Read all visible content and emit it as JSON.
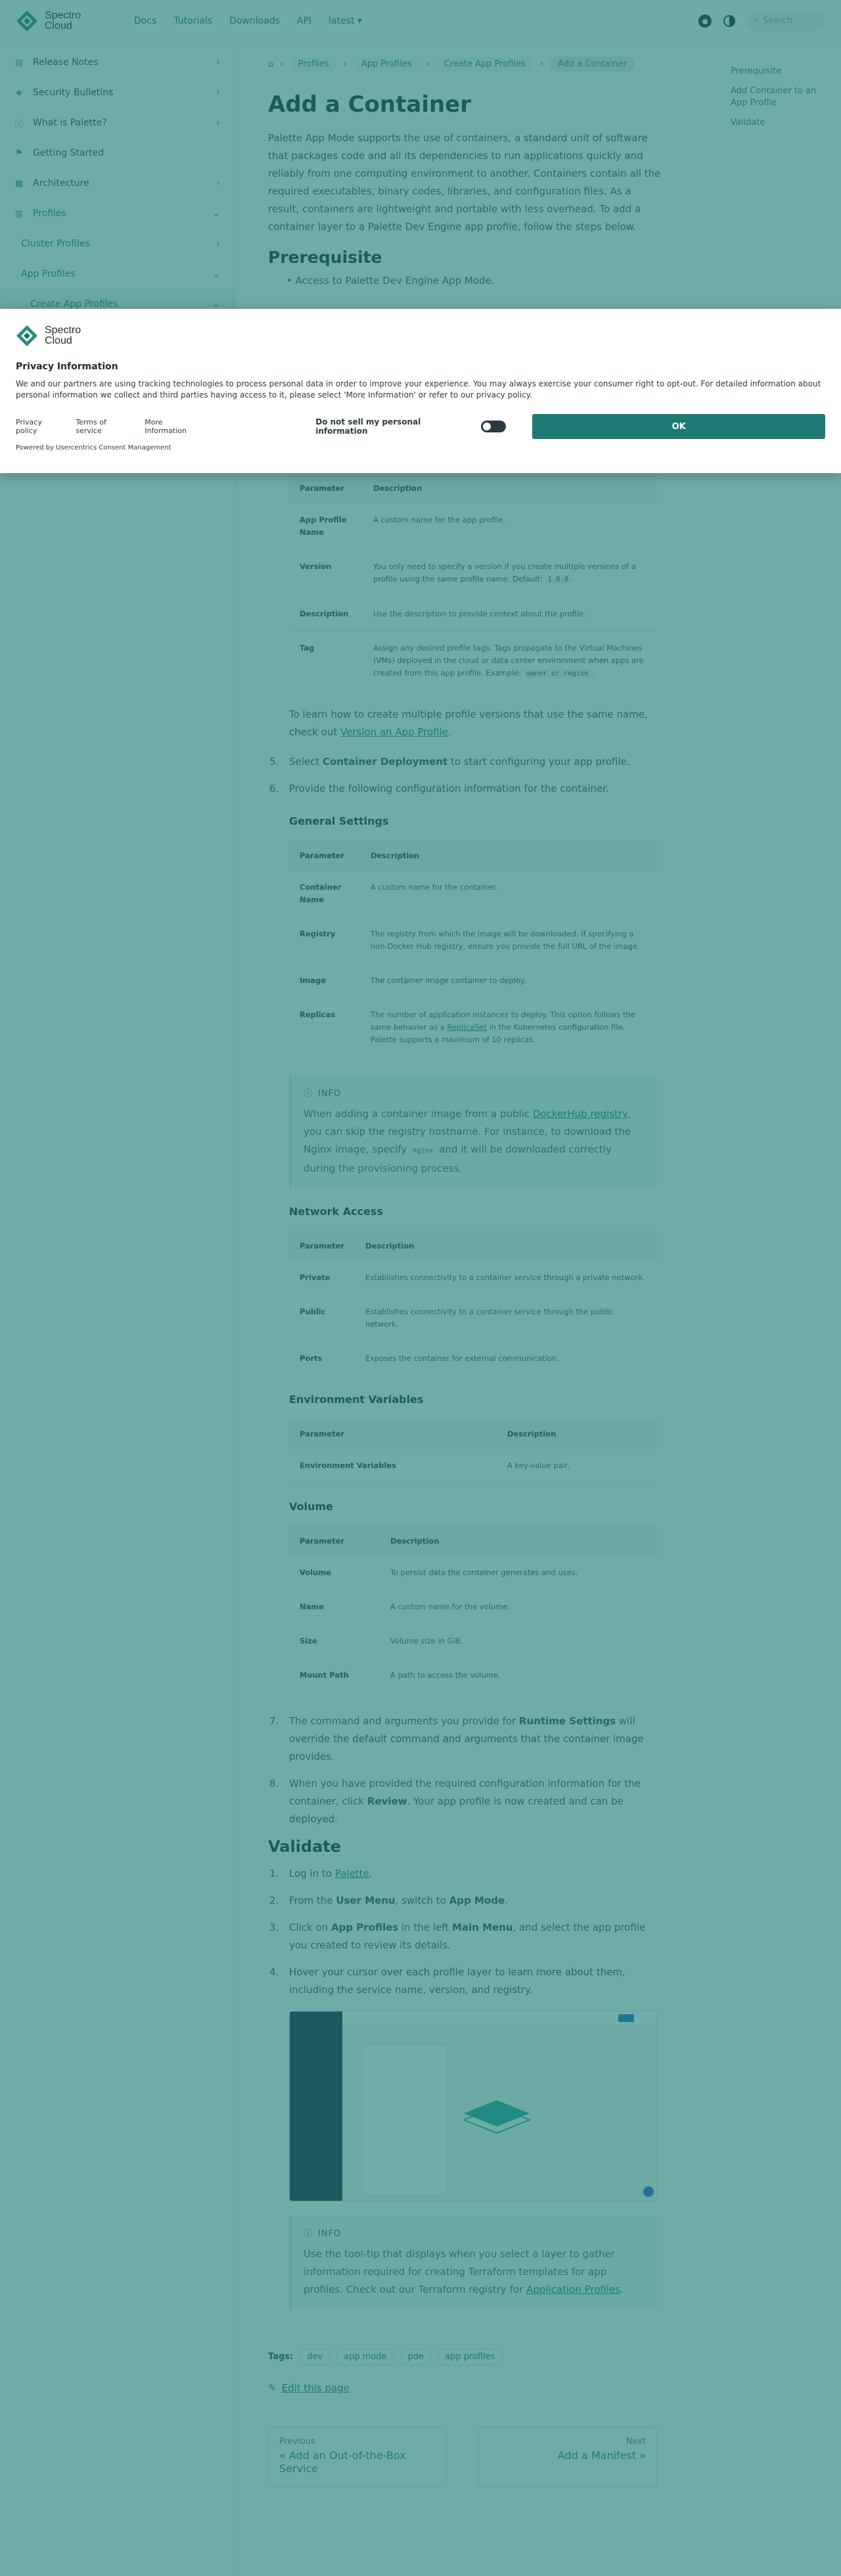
{
  "topnav": {
    "brand_line1": "Spectro",
    "brand_line2": "Cloud",
    "links": [
      "Docs",
      "Tutorials",
      "Downloads",
      "API",
      "latest"
    ],
    "search_placeholder": "Search"
  },
  "sidebar": {
    "items": [
      {
        "label": "Release Notes",
        "icon": "document-icon"
      },
      {
        "label": "Security Bulletins",
        "icon": "shield-icon"
      },
      {
        "label": "What is Palette?",
        "icon": "info-icon"
      },
      {
        "label": "Getting Started",
        "icon": "flag-icon"
      },
      {
        "label": "Architecture",
        "icon": "architecture-icon"
      },
      {
        "label": "Profiles",
        "icon": "layers-icon"
      }
    ],
    "sub": [
      "Cluster Profiles",
      "App Profiles",
      "Create App Profiles"
    ]
  },
  "breadcrumbs": [
    "Profiles",
    "App Profiles",
    "Create App Profiles",
    "Add a Container"
  ],
  "toc": [
    "Prerequisite",
    "Add Container to an App Profile",
    "Validate"
  ],
  "page": {
    "title": "Add a Container",
    "intro": "Palette App Mode supports the use of containers, a standard unit of software that packages code and all its dependencies to run applications quickly and reliably from one computing environment to another. Containers contain all the required executables, binary codes, libraries, and configuration files. As a result, containers are lightweight and portable with less overhead. To add a container layer to a Palette Dev Engine app profile, follow the steps below.",
    "prereq_heading": "Prerequisite",
    "prereq_item": "Access to Palette Dev Engine App Mode."
  },
  "consent": {
    "brand_line1": "Spectro",
    "brand_line2": "Cloud",
    "title": "Privacy Information",
    "text": "We and our partners are using tracking technologies to process personal data in order to improve your experience. You may always exercise your consumer right to opt-out. For detailed information about personal information we collect and third parties having access to it, please select 'More Information' or refer to our privacy policy.",
    "links": [
      "Privacy policy",
      "Terms of service",
      "More Information"
    ],
    "dns_label": "Do not sell my personal information",
    "ok_label": "OK",
    "powered": "Powered by Usercentrics Consent Management"
  },
  "profile_table": {
    "headers": [
      "Parameter",
      "Description"
    ],
    "rows": [
      {
        "k": "App Profile Name",
        "v": "A custom name for the app profile."
      },
      {
        "k": "Version",
        "v": "You only need to specify a version if you create multiple versions of a profile using the same profile name. Default:",
        "code": "1.0.0"
      },
      {
        "k": "Description",
        "v": "Use the description to provide context about the profile."
      },
      {
        "k": "Tag",
        "v": "Assign any desired profile tags. Tags propagate to the Virtual Machines (VMs) deployed in the cloud or data center environment when apps are created from this app profile. Example:",
        "code": "owner or region"
      }
    ]
  },
  "version_note": {
    "pre": "To learn how to create multiple profile versions that use the same name, check out ",
    "link": "Version an App Profile",
    "post": "."
  },
  "steps": {
    "s5_num": "5.",
    "s5_pre": "Select ",
    "s5_bold": "Container Deployment",
    "s5_post": " to start configuring your app profile.",
    "s6_num": "6.",
    "s6": "Provide the following configuration information for the container."
  },
  "general": {
    "heading": "General Settings",
    "headers": [
      "Parameter",
      "Description"
    ],
    "rows": [
      {
        "k": "Container Name",
        "v": "A custom name for the container."
      },
      {
        "k": "Registry",
        "v": "The registry from which the image will be downloaded. If specifying a non-Docker Hub registry, ensure you provide the full URL of the image."
      },
      {
        "k": "Image",
        "v": "The container image container to deploy."
      },
      {
        "k": "Replicas",
        "v_pre": "The number of application instances to deploy. This option follows the same behavior as a ",
        "v_link": "ReplicaSet",
        "v_post": " in the Kubernetes configuration file. Palette supports a maximum of 10 replicas."
      }
    ]
  },
  "info1": {
    "label": "INFO",
    "pre": "When adding a container image from a public ",
    "link": "DockerHub registry",
    "mid": ", you can skip the registry hostname. For instance, to download the Nginx image, specify ",
    "code": "nginx",
    "post": " and it will be downloaded correctly during the provisioning process."
  },
  "network": {
    "heading": "Network Access",
    "headers": [
      "Parameter",
      "Description"
    ],
    "rows": [
      {
        "k": "Private",
        "v": "Establishes connectivity to a container service through a private network."
      },
      {
        "k": "Public",
        "v": "Establishes connectivity to a container service through the public network."
      },
      {
        "k": "Ports",
        "v": "Exposes the container for external communication."
      }
    ]
  },
  "env": {
    "heading": "Environment Variables",
    "headers": [
      "Parameter",
      "Description"
    ],
    "rows": [
      {
        "k": "Environment Variables",
        "v": "A key-value pair."
      }
    ]
  },
  "volume": {
    "heading": "Volume",
    "headers": [
      "Parameter",
      "Description"
    ],
    "rows": [
      {
        "k": "Volume",
        "v": "To persist data the container generates and uses."
      },
      {
        "k": "Name",
        "v": "A custom name for the volume."
      },
      {
        "k": "Size",
        "v": "Volume size in GiB."
      },
      {
        "k": "Mount Path",
        "v": "A path to access the volume."
      }
    ]
  },
  "steps2": {
    "s7_num": "7.",
    "s7_pre": "The command and arguments you provide for ",
    "s7_bold": "Runtime Settings",
    "s7_post": " will override the default command and arguments that the container image provides.",
    "s8_num": "8.",
    "s8_pre": "When you have provided the required configuration information for the container, click ",
    "s8_bold": "Review",
    "s8_post": ". Your app profile is now created and can be deployed."
  },
  "validate": {
    "heading": "Validate",
    "v1_num": "1.",
    "v1_pre": "Log in to ",
    "v1_link": "Palette",
    "v1_post": ".",
    "v2_num": "2.",
    "v2_pre": "From the ",
    "v2_b1": "User Menu",
    "v2_mid": ", switch to ",
    "v2_b2": "App Mode",
    "v2_post": ".",
    "v3_num": "3.",
    "v3_pre": "Click on ",
    "v3_b1": "App Profiles",
    "v3_mid": " in the left ",
    "v3_b2": "Main Menu",
    "v3_post": ", and select the app profile you created to review its details.",
    "v4_num": "4.",
    "v4": "Hover your cursor over each profile layer to learn more about them, including the service name, version, and registry."
  },
  "info2": {
    "label": "INFO",
    "pre": "Use the tool-tip that displays when you select a layer to gather information required for creating Terraform templates for app profiles. Check out our Terraform registry for ",
    "link": "Application Profiles",
    "post": "."
  },
  "tags": {
    "label": "Tags:",
    "items": [
      "dev",
      "app mode",
      "pde",
      "app profiles"
    ]
  },
  "edit_label": "Edit this page",
  "pager": {
    "prev_sub": "Previous",
    "prev_title": "« Add an Out-of-the-Box Service",
    "next_sub": "Next",
    "next_title": "Add a Manifest »"
  }
}
